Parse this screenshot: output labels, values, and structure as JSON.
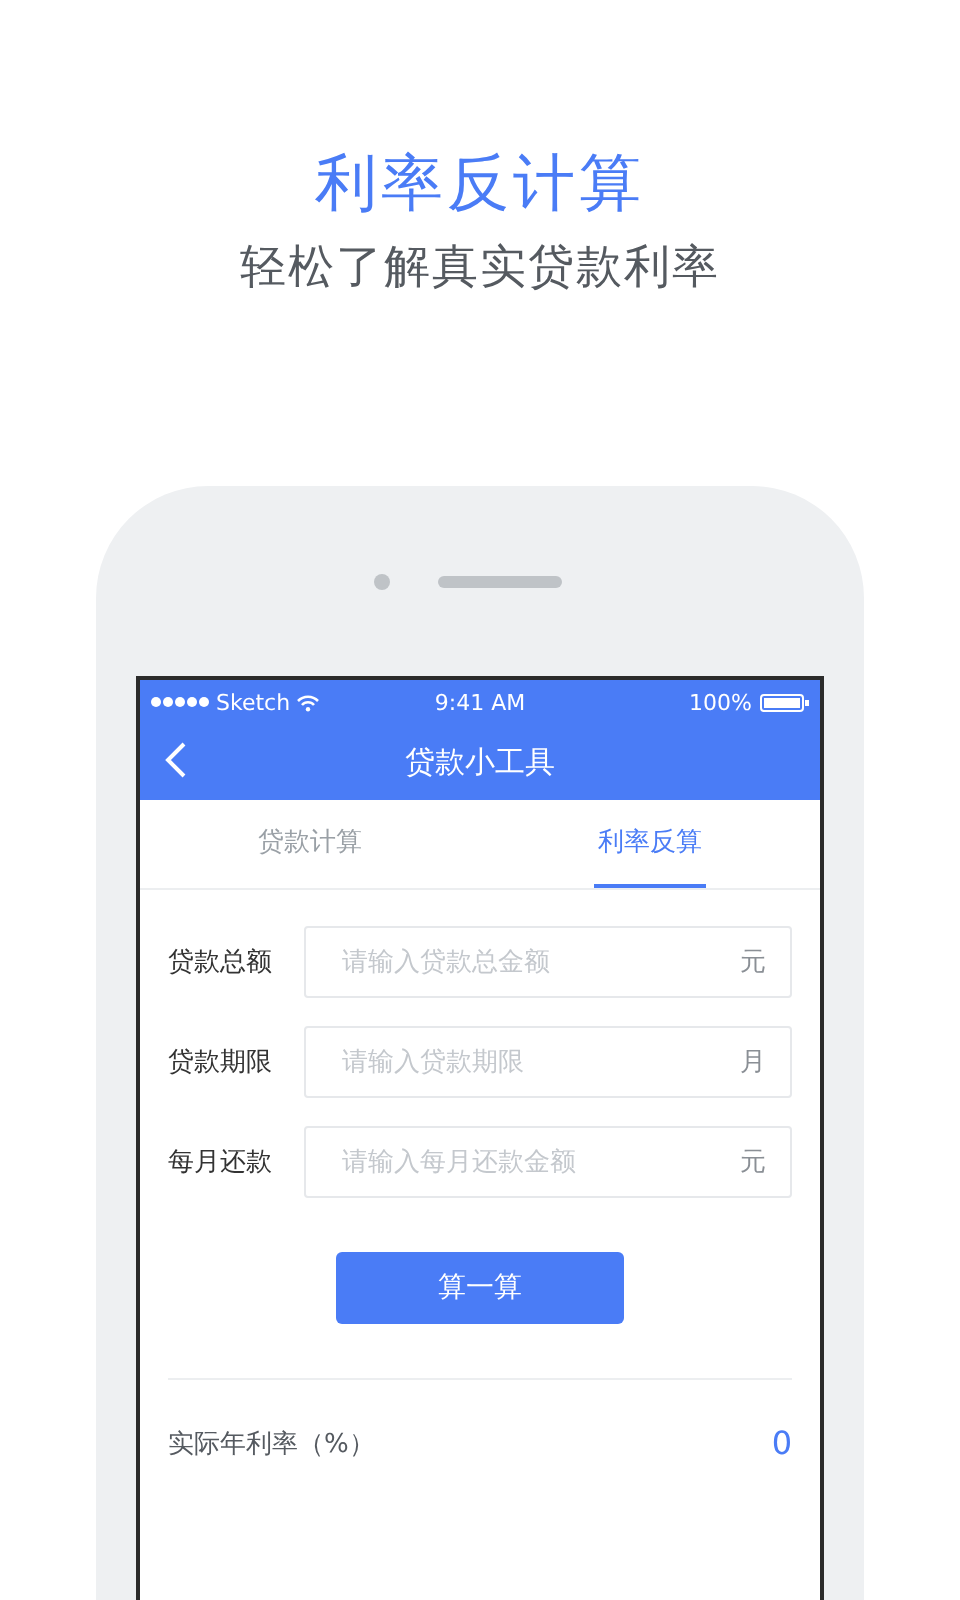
{
  "headline": "利率反计算",
  "subtitle": "轻松了解真实贷款利率",
  "status_bar": {
    "carrier": "Sketch",
    "time": "9:41 AM",
    "battery": "100%"
  },
  "nav": {
    "title": "贷款小工具"
  },
  "tabs": [
    {
      "label": "贷款计算",
      "selected": false
    },
    {
      "label": "利率反算",
      "selected": true
    }
  ],
  "fields": [
    {
      "label": "贷款总额",
      "placeholder": "请输入贷款总金额",
      "unit": "元"
    },
    {
      "label": "贷款期限",
      "placeholder": "请输入贷款期限",
      "unit": "月"
    },
    {
      "label": "每月还款",
      "placeholder": "请输入每月还款金额",
      "unit": "元"
    }
  ],
  "button": "算一算",
  "result": {
    "label": "实际年利率（%）",
    "value": "0"
  }
}
